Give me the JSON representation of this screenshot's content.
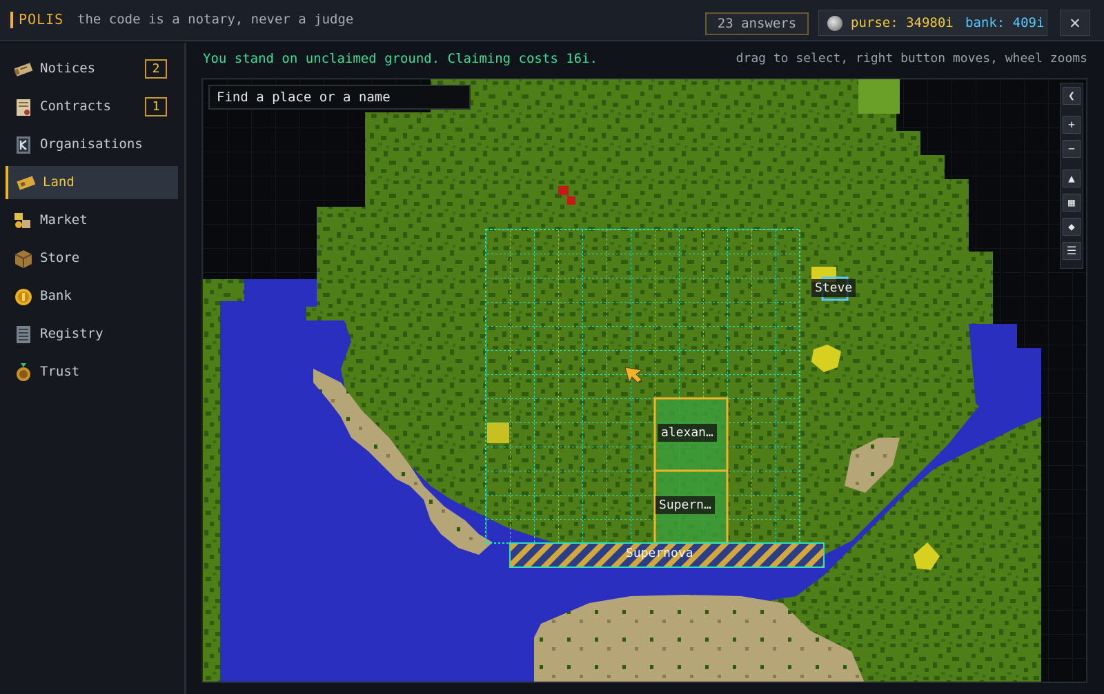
{
  "header": {
    "brand": "POLIS",
    "motto": "the code is a notary, never a judge",
    "answers": "23 answers",
    "purse": "purse: 34980i",
    "bank": "bank: 409i",
    "close_glyph": "✕"
  },
  "sidebar": {
    "items": [
      {
        "label": "Notices",
        "icon": "scroll-icon",
        "badge": "2",
        "active": false
      },
      {
        "label": "Contracts",
        "icon": "contract-icon",
        "badge": "1",
        "active": false
      },
      {
        "label": "Organisations",
        "icon": "banner-icon",
        "badge": "",
        "active": false
      },
      {
        "label": "Land",
        "icon": "land-deed-icon",
        "badge": "",
        "active": true
      },
      {
        "label": "Market",
        "icon": "market-icon",
        "badge": "",
        "active": false
      },
      {
        "label": "Store",
        "icon": "crate-icon",
        "badge": "",
        "active": false
      },
      {
        "label": "Bank",
        "icon": "gold-coin-icon",
        "badge": "",
        "active": false
      },
      {
        "label": "Registry",
        "icon": "ledger-icon",
        "badge": "",
        "active": false
      },
      {
        "label": "Trust",
        "icon": "handshake-icon",
        "badge": "",
        "active": false
      }
    ]
  },
  "main": {
    "status": "You stand on unclaimed ground. Claiming costs 16i.",
    "hint": "drag to select, right button moves, wheel zooms",
    "search_placeholder": "Find a place or a name"
  },
  "map": {
    "labels": {
      "steve": "Steve",
      "alexan": "alexan…",
      "supern": "Supern…",
      "supernova": "Supernova"
    },
    "tools": [
      {
        "name": "collapse-panel-button",
        "glyph": "❮"
      },
      {
        "name": "zoom-in-button",
        "glyph": "+"
      },
      {
        "name": "zoom-out-button",
        "glyph": "−"
      },
      {
        "name": "north-up-button",
        "glyph": "▲"
      },
      {
        "name": "grid-toggle-button",
        "glyph": "▦"
      },
      {
        "name": "waypoint-button",
        "glyph": "◆"
      },
      {
        "name": "list-view-button",
        "glyph": "☰"
      }
    ],
    "colors": {
      "grass": "#4f7d18",
      "forest": "#2e5c10",
      "water": "#2b2fc0",
      "sand": "#b6a677",
      "grid": "#2de0b8",
      "claim": "#f0b429"
    }
  }
}
